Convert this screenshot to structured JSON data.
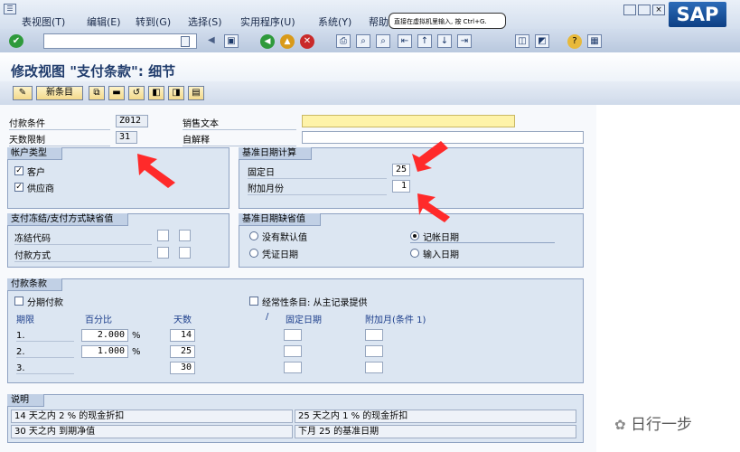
{
  "menu": {
    "items": [
      "表视图(T)",
      "编辑(E)",
      "转到(G)",
      "选择(S)",
      "实用程序(U)",
      "系统(Y)",
      "帮助"
    ],
    "tooltip": "直接在虚拟机里输入, 按 Ctrl+G."
  },
  "brand": {
    "logo": "SAP"
  },
  "page": {
    "title": "修改视图 \"支付条款\": 细节"
  },
  "app_toolbar": {
    "new_entries": "新条目"
  },
  "header": {
    "payment_terms_label": "付款条件",
    "payment_terms_value": "Z012",
    "day_limit_label": "天数限制",
    "day_limit_value": "31",
    "sales_text_label": "销售文本",
    "sales_text_value": "",
    "explanation_label": "自解释",
    "explanation_value": ""
  },
  "account_type": {
    "title": "帐户类型",
    "customer": "客户",
    "vendor": "供应商"
  },
  "baseline_calc": {
    "title": "基准日期计算",
    "fixed_day_label": "固定日",
    "fixed_day_value": "25",
    "add_months_label": "附加月份",
    "add_months_value": "1"
  },
  "block_defaults": {
    "title": "支付冻结/支付方式缺省值",
    "block_key_label": "冻结代码",
    "payment_method_label": "付款方式"
  },
  "baseline_defaults": {
    "title": "基准日期缺省值",
    "no_default": "没有默认值",
    "posting_date": "记帐日期",
    "document_date": "凭证日期",
    "entry_date": "输入日期"
  },
  "terms": {
    "title": "付款条款",
    "installment": "分期付款",
    "recurring": "经常性条目: 从主记录提供",
    "col_term": "期限",
    "col_percent": "百分比",
    "col_days": "天数",
    "col_slash": "/",
    "col_fixed_day": "固定日期",
    "col_add_month": "附加月(条件 1)",
    "rows": [
      {
        "term": "1.",
        "percent": "2.000",
        "unit": "%",
        "days": "14"
      },
      {
        "term": "2.",
        "percent": "1.000",
        "unit": "%",
        "days": "25"
      },
      {
        "term": "3.",
        "percent": "",
        "unit": "",
        "days": "30"
      }
    ]
  },
  "explanation": {
    "title": "说明",
    "lines": [
      "14 天之内 2 % 的现金折扣",
      "25 天之内 1 % 的现金折扣",
      "30 天之内 到期净值",
      "下月 25 的基准日期"
    ]
  },
  "watermark": "日行一步",
  "colors": {
    "arrow": "#ff2a2a",
    "field_yellow": "#fef3a9",
    "group_bg": "#dce6f2"
  }
}
